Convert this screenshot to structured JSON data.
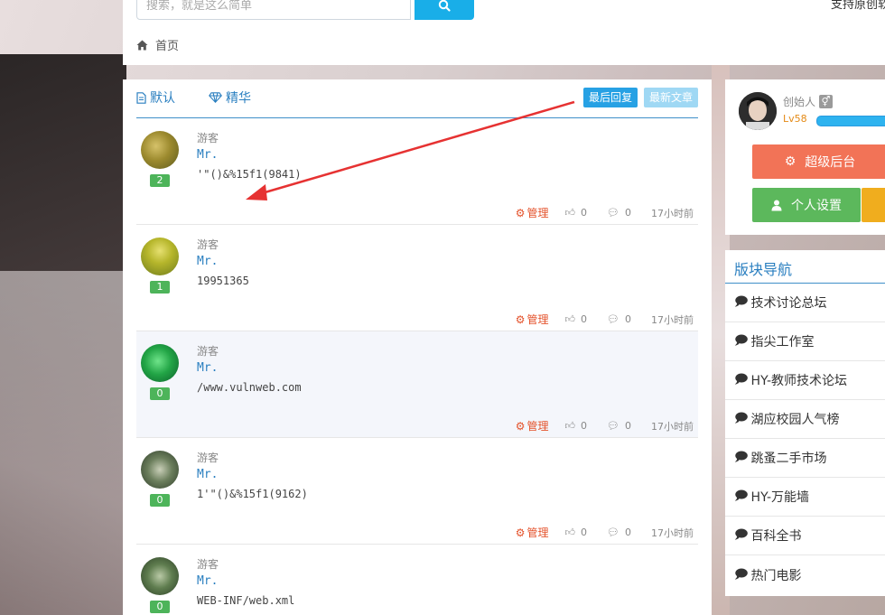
{
  "header": {
    "search_placeholder": "搜索，就是这么简单",
    "support_text": "支持原创软件",
    "breadcrumb_home": "首页"
  },
  "tabs": {
    "default_label": "默认",
    "elite_label": "精华",
    "sort_last_reply": "最后回复",
    "sort_newest": "最新文章"
  },
  "posts": [
    {
      "badge": "2",
      "type": "游客",
      "name": "Mr.",
      "content": "'\"()&%15f1(9841)",
      "manage": "管理",
      "likes": "0",
      "comments": "0",
      "time": "17小时前"
    },
    {
      "badge": "1",
      "type": "游客",
      "name": "Mr.",
      "content": "19951365",
      "manage": "管理",
      "likes": "0",
      "comments": "0",
      "time": "17小时前"
    },
    {
      "badge": "0",
      "type": "游客",
      "name": "Mr.",
      "content": "/www.vulnweb.com",
      "manage": "管理",
      "likes": "0",
      "comments": "0",
      "time": "17小时前"
    },
    {
      "badge": "0",
      "type": "游客",
      "name": "Mr.",
      "content": "1'\"()&%15f1(9162)",
      "manage": "管理",
      "likes": "0",
      "comments": "0",
      "time": "17小时前"
    },
    {
      "badge": "0",
      "type": "游客",
      "name": "Mr.",
      "content": "WEB-INF/web.xml",
      "manage": "管理",
      "likes": "0",
      "comments": "0",
      "time": "17小时前"
    }
  ],
  "profile": {
    "username": "创始人",
    "gender_symbol": "⚥",
    "level": "Lv58",
    "admin_button": "超级后台",
    "settings_button": "个人设置"
  },
  "board_nav": {
    "title": "版块导航",
    "items": [
      "技术讨论总坛",
      "指尖工作室",
      "HY-教师技术论坛",
      "湖应校园人气榜",
      "跳蚤二手市场",
      "HY-万能墙",
      "百科全书",
      "热门电影"
    ]
  },
  "colors": {
    "accent_blue": "#2a7fc0",
    "search_button": "#19aee8",
    "admin_button": "#f27357",
    "settings_button": "#5cb85c",
    "badge_green": "#4db45a",
    "manage_orange": "#e4522b",
    "arrow_red": "#e63232"
  }
}
